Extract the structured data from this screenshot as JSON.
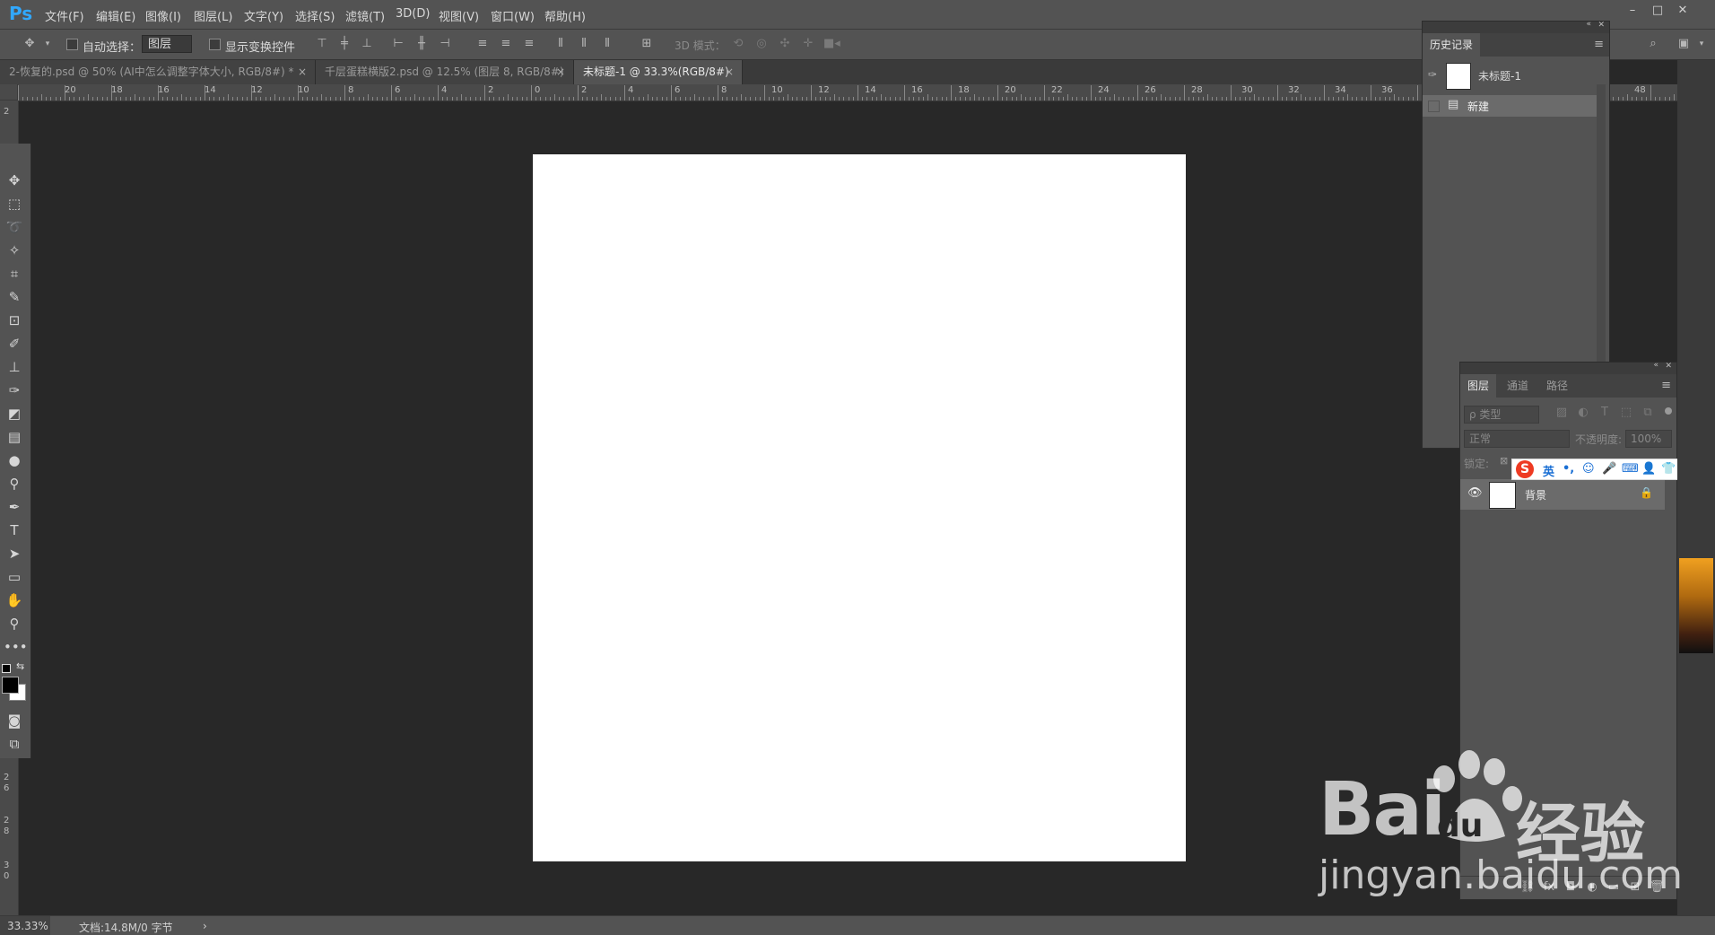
{
  "app": {
    "logo": "Ps"
  },
  "menu": [
    "文件(F)",
    "编辑(E)",
    "图像(I)",
    "图层(L)",
    "文字(Y)",
    "选择(S)",
    "滤镜(T)",
    "3D(D)",
    "视图(V)",
    "窗口(W)",
    "帮助(H)"
  ],
  "window_controls": {
    "minimize": "–",
    "maximize": "□",
    "close": "✕"
  },
  "options": {
    "auto_select_label": "自动选择：",
    "auto_select_value": "图层",
    "show_transform_label": "显示变换控件",
    "mode_3d_label": "3D 模式："
  },
  "tabs": [
    {
      "label": "2-恢复的.psd @ 50% (AI中怎么调整字体大小, RGB/8#) *",
      "close": "×"
    },
    {
      "label": "千层蛋糕横版2.psd @ 12.5% (图层 8, RGB/8#)",
      "close": "×"
    },
    {
      "label": "未标题-1 @ 33.3%(RGB/8#)",
      "close": "×"
    }
  ],
  "ruler": {
    "top_numbers": [
      "20",
      "18",
      "16",
      "14",
      "12",
      "10",
      "8",
      "6",
      "4",
      "2",
      "0",
      "2",
      "4",
      "6",
      "8",
      "10",
      "12",
      "14",
      "16",
      "18",
      "20",
      "22",
      "24",
      "26",
      "28",
      "30",
      "32",
      "34",
      "36",
      "46",
      "48"
    ],
    "left_numbers": [
      "2",
      "2",
      "6",
      "2",
      "8",
      "3",
      "0"
    ]
  },
  "tools": [
    "move-icon",
    "marquee-icon",
    "lasso-icon",
    "magic-wand-icon",
    "crop-icon",
    "eyedropper-icon",
    "patch-icon",
    "brush-icon",
    "stamp-icon",
    "history-brush-icon",
    "eraser-icon",
    "gradient-icon",
    "blur-icon",
    "dodge-icon",
    "pen-icon",
    "type-icon",
    "path-select-icon",
    "rectangle-icon",
    "hand-icon",
    "zoom-icon",
    "more-icon"
  ],
  "history": {
    "tab": "历史记录",
    "snapshot": "未标题-1",
    "items": [
      "新建"
    ]
  },
  "layers": {
    "tabs": [
      "图层",
      "通道",
      "路径"
    ],
    "filter_placeholder": "ρ 类型",
    "blend_mode": "正常",
    "opacity_label": "不透明度:",
    "opacity_value": "100%",
    "lock_label": "锁定:",
    "layer_name": "背景"
  },
  "ime": {
    "lang": "英"
  },
  "status": {
    "zoom": "33.33%",
    "doc_info": "文档:14.8M/0 字节",
    "arrow": "›"
  },
  "watermark": {
    "logo_left": "Bai",
    "logo_right": "经验",
    "du": "du",
    "url": "jingyan.baidu.com"
  }
}
